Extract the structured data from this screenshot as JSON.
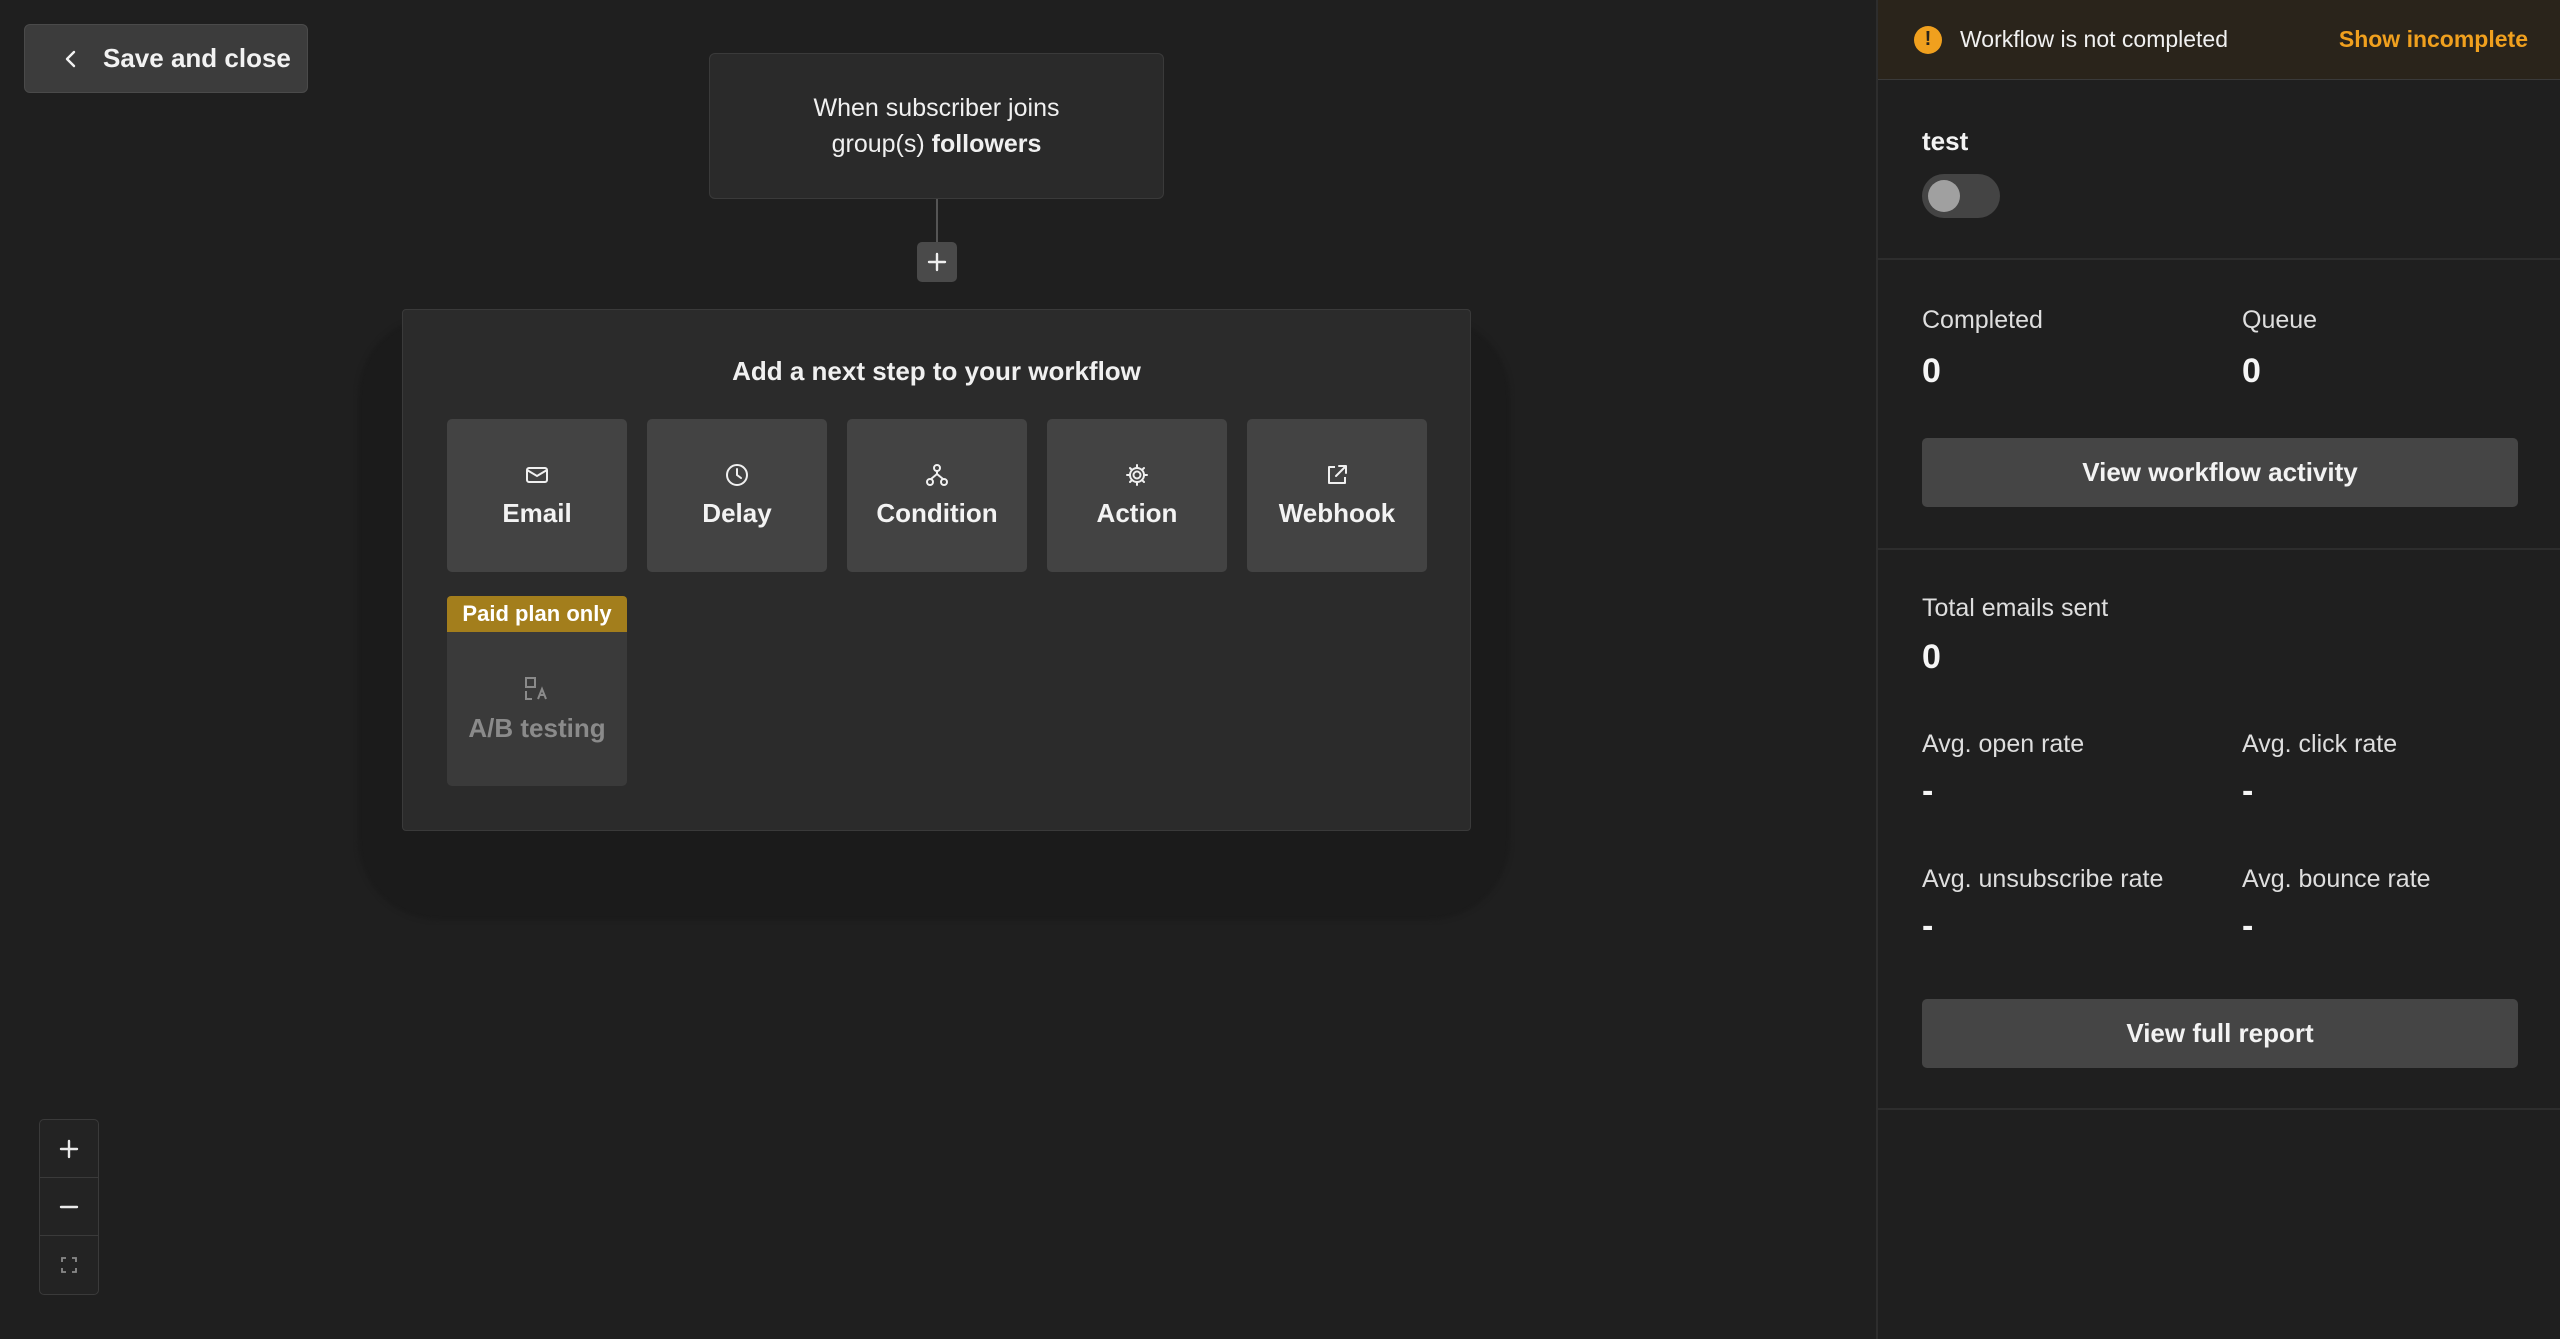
{
  "toolbar": {
    "save_label": "Save and close"
  },
  "trigger": {
    "prefix": "When subscriber joins",
    "mid": "group(s)",
    "group": "followers"
  },
  "steps": {
    "title": "Add a next step to your workflow",
    "items": [
      {
        "label": "Email",
        "icon": "mail-icon"
      },
      {
        "label": "Delay",
        "icon": "clock-icon"
      },
      {
        "label": "Condition",
        "icon": "branch-icon"
      },
      {
        "label": "Action",
        "icon": "gear-icon"
      },
      {
        "label": "Webhook",
        "icon": "external-link-icon"
      }
    ],
    "paid_badge": "Paid plan only",
    "ab_label": "A/B testing"
  },
  "alert": {
    "message": "Workflow is not completed",
    "action": "Show incomplete",
    "color": "#f0a01e"
  },
  "sidebar": {
    "workflow_name": "test",
    "completed_label": "Completed",
    "completed_value": "0",
    "queue_label": "Queue",
    "queue_value": "0",
    "activity_button": "View workflow activity",
    "total_sent_label": "Total emails sent",
    "total_sent_value": "0",
    "open_rate_label": "Avg. open rate",
    "open_rate_value": "-",
    "click_rate_label": "Avg. click rate",
    "click_rate_value": "-",
    "unsub_rate_label": "Avg. unsubscribe rate",
    "unsub_rate_value": "-",
    "bounce_rate_label": "Avg. bounce rate",
    "bounce_rate_value": "-",
    "report_button": "View full report"
  }
}
